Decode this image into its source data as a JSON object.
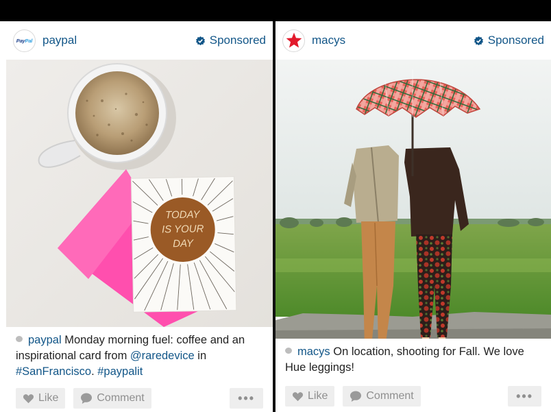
{
  "posts": [
    {
      "username": "paypal",
      "avatar_text_1": "Pay",
      "avatar_text_2": "Pal",
      "sponsored_label": "Sponsored",
      "photo_card_lines": [
        "TODAY",
        "IS YOUR",
        "DAY"
      ],
      "caption": {
        "username": "paypal",
        "text_before": " Monday morning fuel: coffee and an inspirational card from ",
        "mention": "@raredevice",
        "text_middle": " in ",
        "hashtag_1": "#SanFrancisco",
        "text_sep": ". ",
        "hashtag_2": "#paypalit"
      },
      "actions": {
        "like": "Like",
        "comment": "Comment",
        "more": "•••"
      }
    },
    {
      "username": "macys",
      "sponsored_label": "Sponsored",
      "caption": {
        "username": "macys",
        "text": " On location, shooting for Fall. We love Hue leggings!"
      },
      "actions": {
        "like": "Like",
        "comment": "Comment",
        "more": "•••"
      }
    }
  ],
  "colors": {
    "link_blue": "#125688",
    "macys_red": "#e21a2c",
    "card_pink": "#ff5bb0",
    "sun_brown": "#9a5a26"
  },
  "icons": [
    "sponsored-badge-icon",
    "heart-icon",
    "comment-bubble-icon",
    "macys-star-icon",
    "paypal-logo"
  ]
}
